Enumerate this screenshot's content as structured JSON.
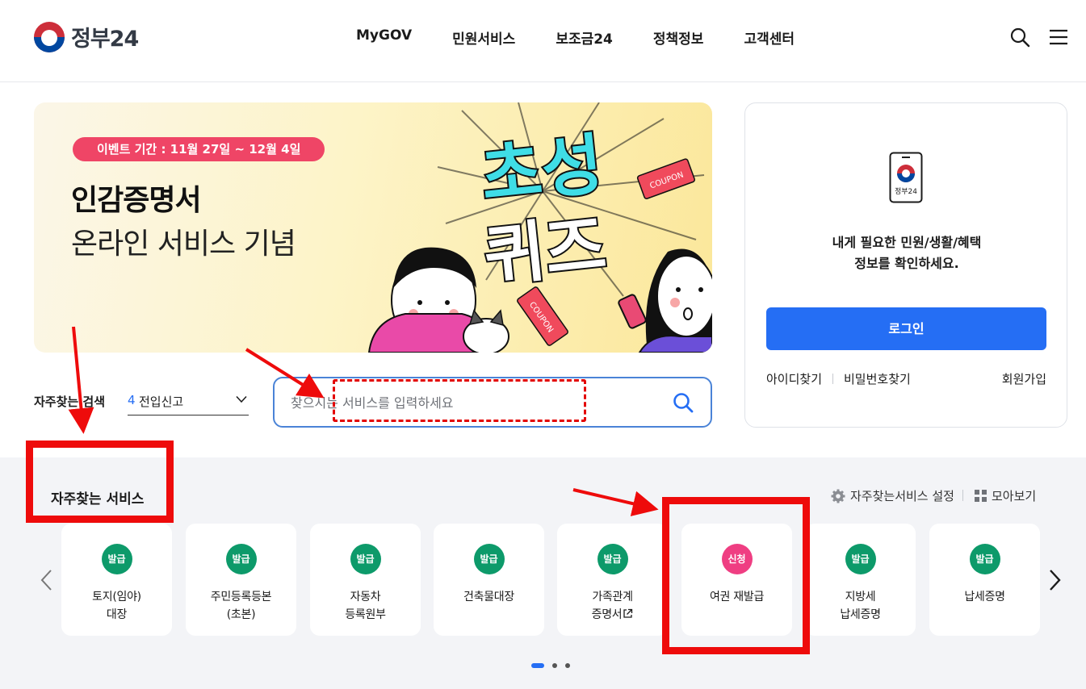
{
  "header": {
    "logo_text": "정부24",
    "nav": [
      "MyGOV",
      "민원서비스",
      "보조금24",
      "정책정보",
      "고객센터"
    ],
    "search_icon": "search-icon",
    "menu_icon": "hamburger-menu-icon"
  },
  "banner": {
    "event_period": "이벤트 기간 : 11월 27일 ~ 12월 4일",
    "title": "인감증명서",
    "subtitle": "온라인 서비스 기념",
    "art_title_top": "초성",
    "art_title_bottom": "퀴즈",
    "coupon_label": "COUPON",
    "colors": {
      "pill": "#ef4566",
      "quiz_text": "#3fdde6"
    }
  },
  "login_card": {
    "app_label": "정부24",
    "description_line1": "내게 필요한 민원/생활/혜택",
    "description_line2": "정보를 확인하세요.",
    "login_button": "로그인",
    "find_id": "아이디찾기",
    "find_password": "비밀번호찾기",
    "sign_up": "회원가입"
  },
  "search": {
    "frequent_label": "자주찾는 검색",
    "frequent_selected_number": "4",
    "frequent_selected_text": "전입신고",
    "placeholder": "찾으시는 서비스를 입력하세요"
  },
  "services": {
    "title": "자주찾는 서비스",
    "settings_label": "자주찾는서비스 설정",
    "view_all_label": "모아보기",
    "items": [
      {
        "badge": "발급",
        "badge_type": "issue",
        "line1": "토지(임야)",
        "line2": "대장"
      },
      {
        "badge": "발급",
        "badge_type": "issue",
        "line1": "주민등록등본",
        "line2": "(초본)"
      },
      {
        "badge": "발급",
        "badge_type": "issue",
        "line1": "자동차",
        "line2": "등록원부"
      },
      {
        "badge": "발급",
        "badge_type": "issue",
        "line1": "건축물대장",
        "line2": ""
      },
      {
        "badge": "발급",
        "badge_type": "issue",
        "line1": "가족관계",
        "line2": "증명서",
        "external_link": true
      },
      {
        "badge": "신청",
        "badge_type": "apply",
        "line1": "여권 재발급",
        "line2": ""
      },
      {
        "badge": "발급",
        "badge_type": "issue",
        "line1": "지방세",
        "line2": "납세증명"
      },
      {
        "badge": "발급",
        "badge_type": "issue",
        "line1": "납세증명",
        "line2": ""
      }
    ],
    "page_indicator": {
      "current": 1,
      "total": 3
    },
    "colors": {
      "issue": "#0d9a6a",
      "apply": "#ef3e82"
    }
  },
  "annotation_colors": {
    "highlight": "#ee0b0b"
  }
}
